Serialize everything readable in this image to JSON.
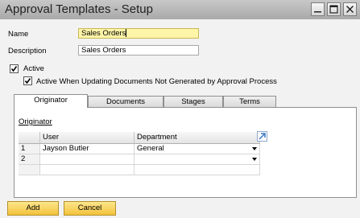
{
  "window": {
    "title": "Approval Templates - Setup"
  },
  "form": {
    "name_label": "Name",
    "name_value": "Sales Orders",
    "description_label": "Description",
    "description_value": "Sales Orders",
    "active_label": "Active",
    "active_checked": true,
    "active_updating_label": "Active When Updating Documents Not Generated by Approval Process",
    "active_updating_checked": true
  },
  "tabs": [
    {
      "label": "Originator",
      "active": true
    },
    {
      "label": "Documents",
      "active": false
    },
    {
      "label": "Stages",
      "active": false
    },
    {
      "label": "Terms",
      "active": false
    }
  ],
  "originator": {
    "section_title": "Originator",
    "columns": [
      "#",
      "User",
      "Department"
    ],
    "rows": [
      {
        "num": "1",
        "user": "Jayson Butler",
        "department": "General"
      },
      {
        "num": "2",
        "user": "",
        "department": ""
      }
    ]
  },
  "buttons": {
    "add": "Add",
    "cancel": "Cancel"
  },
  "colors": {
    "button_fill": "#f3c33c",
    "focused_field": "#fff5a8",
    "titlebar": "#b9b9b9"
  }
}
